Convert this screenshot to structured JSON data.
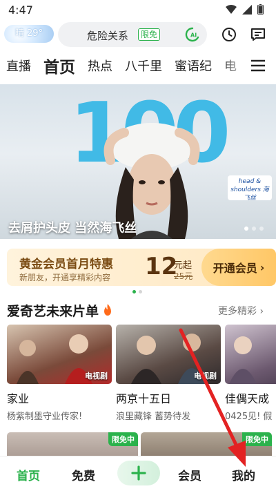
{
  "status_bar": {
    "time": "4:47"
  },
  "header": {
    "weather": "晴 29°",
    "search_text": "危险关系",
    "search_badge": "限免",
    "icons": [
      "history-icon",
      "message-icon",
      "ai-search-icon"
    ]
  },
  "nav_tabs": [
    {
      "label": "直播",
      "active": false
    },
    {
      "label": "首页",
      "active": true
    },
    {
      "label": "热点",
      "active": false
    },
    {
      "label": "八千里",
      "active": false
    },
    {
      "label": "蜜语纪",
      "active": false
    },
    {
      "label": "电",
      "active": false
    }
  ],
  "banner": {
    "headline_number": "100",
    "brand": "head & shoulders 海飞丝",
    "title": "去屑护头皮 当然海飞丝",
    "slide_index": 1,
    "slide_count": 3
  },
  "vip_card": {
    "title": "黄金会员首月特惠",
    "subtitle": "新朋友，开通享精彩内容",
    "price": "12",
    "price_unit": "元起",
    "original_price": "25元",
    "button_label": "开通会员",
    "page_index": 1,
    "page_count": 2
  },
  "section": {
    "title": "爱奇艺未来片单",
    "more_label": "更多精彩"
  },
  "cards": [
    {
      "title": "家业",
      "subtitle": "杨紫制墨守业传家!",
      "tag": "电视剧",
      "color": "#7a4a3a"
    },
    {
      "title": "两京十五日",
      "subtitle": "浪里藏锋 蓄势待发",
      "tag": "电视剧",
      "color": "#5a4a44"
    },
    {
      "title": "佳偶天成",
      "subtitle": "0425见! 假",
      "tag": "",
      "color": "#6d5a70"
    }
  ],
  "row2": [
    {
      "badge": "限免中",
      "color": "#a99a92"
    },
    {
      "badge": "限免中",
      "color": "#8a7c6e"
    }
  ],
  "bottom_nav": [
    {
      "label": "首页",
      "active": true
    },
    {
      "label": "免费",
      "active": false
    },
    {
      "label": "+",
      "active": false
    },
    {
      "label": "会员",
      "active": false
    },
    {
      "label": "我的",
      "active": false
    }
  ],
  "colors": {
    "accent": "#2bb24c",
    "arrow": "#e32222"
  }
}
